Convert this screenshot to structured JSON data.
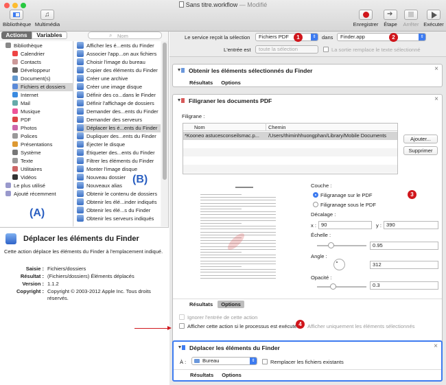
{
  "window": {
    "title": "Sans titre.workflow",
    "title_suffix": "— Modifié"
  },
  "toolbar": {
    "library_label": "Bibliothèque",
    "media_label": "Multimédia",
    "record_label": "Enregistrer",
    "step_label": "Étape",
    "stop_label": "Arrêter",
    "run_label": "Exécuter"
  },
  "leftpane": {
    "seg_actions": "Actions",
    "seg_variables": "Variables",
    "search_placeholder": "Nom",
    "library": [
      "Bibliothèque",
      "Calendrier",
      "Contacts",
      "Développeur",
      "Document(s)",
      "Fichiers et dossiers",
      "Internet",
      "Mail",
      "Musique",
      "PDF",
      "Photos",
      "Polices",
      "Présentations",
      "Système",
      "Texte",
      "Utilitaires",
      "Vidéos",
      "Le plus utilisé",
      "Ajouté récemment"
    ],
    "actions": [
      "Afficher les é...ents du Finder",
      "Associer l'app...on aux fichiers",
      "Choisir l'image du bureau",
      "Copier des éléments du Finder",
      "Créer une archive",
      "Créer une image disque",
      "Définir des co...dans le Finder",
      "Définir l'affichage de dossiers",
      "Demander des...ents du Finder",
      "Demander des serveurs",
      "Déplacer les é...ents du Finder",
      "Dupliquer des...ents du Finder",
      "Éjecter le disque",
      "Étiqueter des...ents du Finder",
      "Filtrer les éléments du Finder",
      "Monter l'image disque",
      "Nouveau dossier",
      "Nouveaux alias",
      "Obtenir le contenu de dossiers",
      "Obtenir les élé...inder indiqués",
      "Obtenir les élé...s du Finder",
      "Obtenir les serveurs indiqués"
    ],
    "label_a": "(A)",
    "label_b": "(B)",
    "description": {
      "title": "Déplacer les éléments du Finder",
      "text": "Cette action déplace les éléments du Finder à l'emplacement indiqué.",
      "rows": [
        {
          "k": "Saisie :",
          "v": "Fichiers/dossiers"
        },
        {
          "k": "Résultat :",
          "v": "(Fichiers/dossiers) Éléments déplacés"
        },
        {
          "k": "Version :",
          "v": "1.1.2"
        },
        {
          "k": "Copyright :",
          "v": "Copyright © 2003-2012 Apple Inc. Tous droits réservés."
        }
      ]
    }
  },
  "service": {
    "receives_label": "Le service reçoit la sélection",
    "receives_value": "Fichiers PDF",
    "in_label": "dans",
    "in_value": "Finder.app",
    "input_label": "L'entrée est",
    "input_value": "toute la sélection",
    "replace_label": "La sortie remplace le texte sélectionné"
  },
  "badges": {
    "b1": "1",
    "b2": "2",
    "b3": "3",
    "b4": "4"
  },
  "card1": {
    "title": "Obtenir les éléments sélectionnés du Finder",
    "tab_results": "Résultats",
    "tab_options": "Options"
  },
  "card2": {
    "title": "Filigraner les documents PDF",
    "watermark_label": "Filigrane :",
    "col_name": "Nom",
    "col_path": "Chemin",
    "row_name": "*Kooneo astucesconseilsmac.p...",
    "row_path": "/Users/thiminhhuongphan/Library/Mobile Documents",
    "add_button": "Ajouter...",
    "remove_button": "Supprimer",
    "layer_label": "Couche :",
    "layer_over": "Filigranage sur le PDF",
    "layer_under": "Filigranage sous le PDF",
    "offset_label": "Décalage :",
    "x_label": "x :",
    "x_value": "90",
    "y_label": "y :",
    "y_value": "390",
    "scale_label": "Échelle :",
    "scale_value": "0.95",
    "scale_level": 0.25,
    "angle_label": "Angle :",
    "angle_value": "312",
    "opacity_label": "Opacité :",
    "opacity_value": "0.3",
    "opacity_level": 0.3,
    "tab_results": "Résultats",
    "tab_options": "Options",
    "ignore_input": "Ignorer l'entrée de cette action",
    "show_when_run": "Afficher cette action si le processus est exécuté",
    "show_selected_only": "Afficher uniquement les éléments sélectionnés"
  },
  "card3": {
    "title": "Déplacer les éléments du Finder",
    "to_label": "À :",
    "to_value": "Bureau",
    "replace_label": "Remplacer les fichiers existants",
    "tab_results": "Résultats",
    "tab_options": "Options"
  },
  "colors": {
    "accent": "#3d7bf0",
    "badge": "#d0161c",
    "annotation": "#2a5fc1"
  }
}
